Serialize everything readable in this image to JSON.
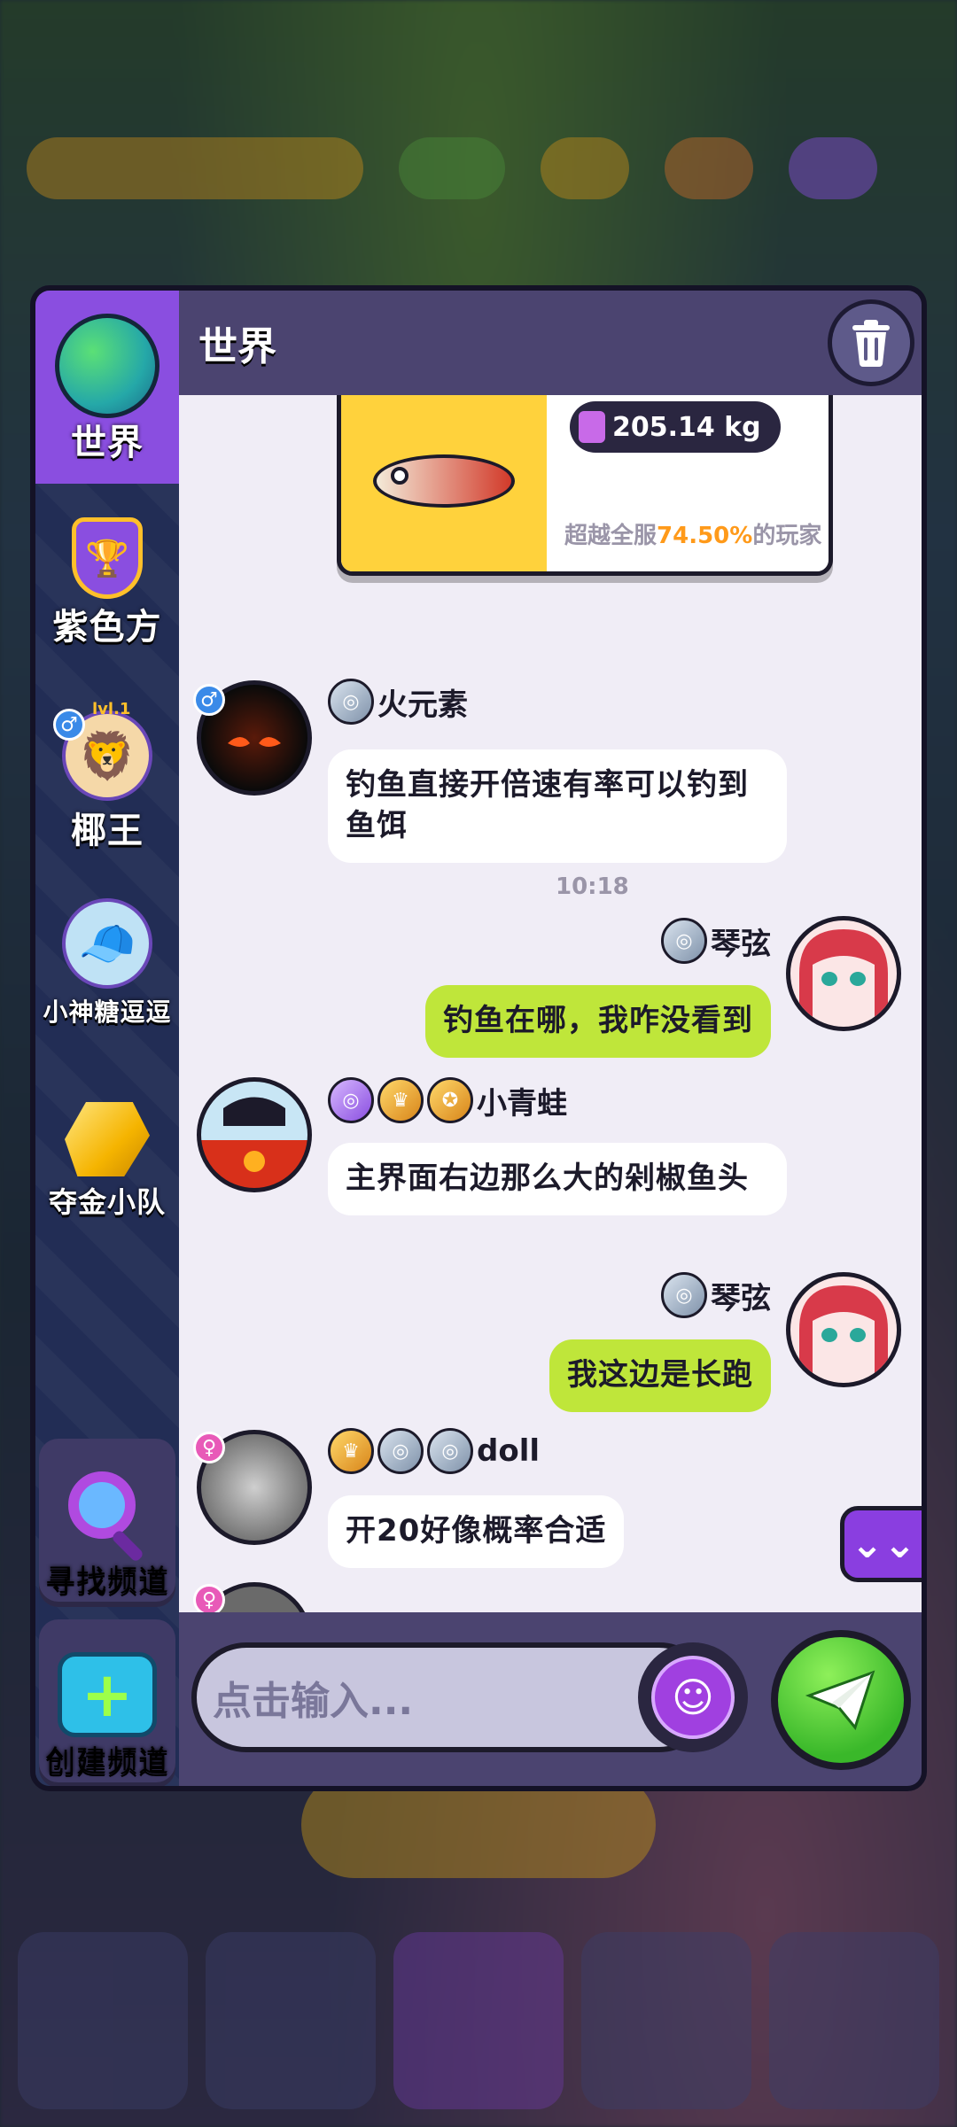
{
  "channels": {
    "world": "世界",
    "purple": "紫色方",
    "king": "椰王",
    "candy": "小神糖逗逗",
    "gold_team": "夺金小队",
    "king_level": "lvl.1"
  },
  "sidebar_buttons": {
    "find": "寻找频道",
    "create": "创建频道"
  },
  "header": {
    "title": "世界"
  },
  "share_card": {
    "weight": "205.14 kg",
    "compare_prefix": "超越全服",
    "compare_percent": "74.50%",
    "compare_suffix": "的玩家"
  },
  "messages": [
    {
      "sender": "火元素",
      "text": "钓鱼直接开倍速有率可以钓到鱼饵",
      "mine": false
    },
    {
      "time": "10:18"
    },
    {
      "sender": "琴弦",
      "text": "钓鱼在哪，我咋没看到",
      "mine": true
    },
    {
      "sender": "小青蛙",
      "text": "主界面右边那么大的剁椒鱼头",
      "mine": false
    },
    {
      "sender": "琴弦",
      "text": "我这边是长跑",
      "mine": true
    },
    {
      "sender": "doll",
      "text": "开20好像概率合适",
      "mine": false
    }
  ],
  "input": {
    "placeholder": "点击输入..."
  },
  "icons": {
    "male": "♂",
    "female": "♀",
    "scroll_down": "⌄⌄",
    "emoji": "☺"
  },
  "colors": {
    "accent_purple": "#8a4ee0",
    "my_bubble": "#bfe63a",
    "highlight": "#ff9a1a"
  }
}
